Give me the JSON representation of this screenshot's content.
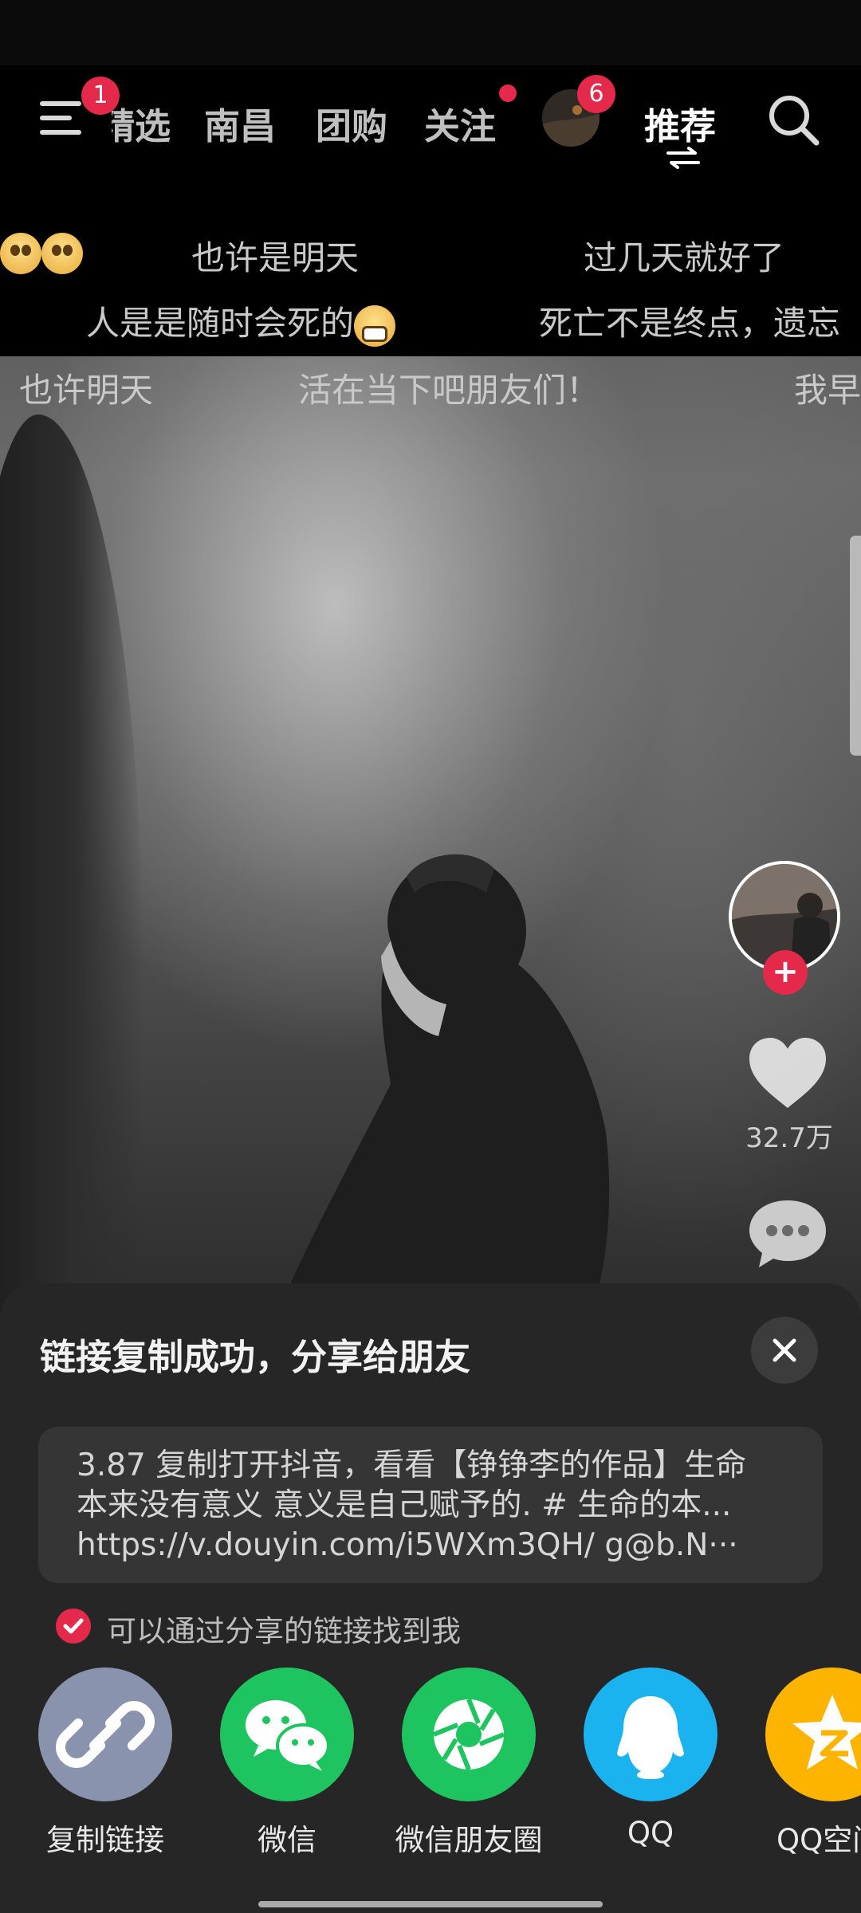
{
  "top_nav": {
    "menu_badge": "1",
    "tabs": [
      "精选",
      "南昌",
      "团购",
      "关注"
    ],
    "live_badge": "6",
    "recommend_label": "推荐"
  },
  "danmaku": [
    {
      "text": "也许是明天"
    },
    {
      "text": "过几天就好了"
    },
    {
      "text": "人是是随时会死的"
    },
    {
      "text": "死亡不是终点，遗忘"
    },
    {
      "text": "也许明天"
    },
    {
      "text": "活在当下吧朋友们！"
    },
    {
      "text": "我早"
    }
  ],
  "video": {
    "like_count": "32.7万"
  },
  "share_sheet": {
    "title": "链接复制成功，分享给朋友",
    "link_lines": [
      "3.87 复制打开抖音，看看【铮铮李的作品】生命",
      "本来没有意义 意义是自己赋予的. # 生命的本...",
      "https://v.douyin.com/i5WXm3QH/ g@b.N···"
    ],
    "findable_label": "可以通过分享的链接找到我",
    "targets": [
      {
        "label": "复制链接",
        "icon": "link-icon",
        "color": "#8a93ad"
      },
      {
        "label": "微信",
        "icon": "wechat-icon",
        "color": "#1ec45f"
      },
      {
        "label": "微信朋友圈",
        "icon": "moments-icon",
        "color": "#1ec45f"
      },
      {
        "label": "QQ",
        "icon": "qq-icon",
        "color": "#1ab2ef"
      },
      {
        "label": "QQ空间",
        "icon": "qzone-icon",
        "color": "#fdb400"
      }
    ]
  }
}
